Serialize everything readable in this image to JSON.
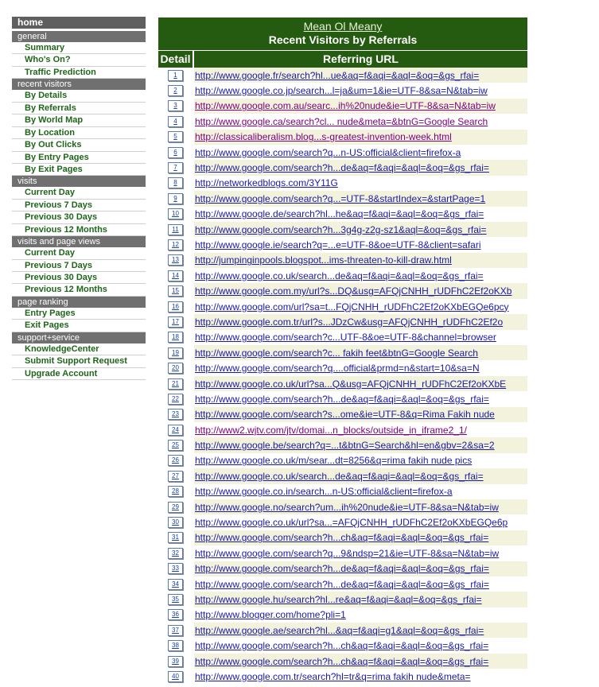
{
  "sidebar": {
    "home": "home",
    "sections": [
      {
        "heading": "general",
        "items": [
          "Summary",
          "Who's On?",
          "Traffic Prediction"
        ]
      },
      {
        "heading": "recent visitors",
        "items": [
          "By Details",
          "By Referrals",
          "By World Map",
          "By Location",
          "By Out Clicks",
          "By Entry Pages",
          "By Exit Pages"
        ]
      },
      {
        "heading": "visits",
        "items": [
          "Current Day",
          "Previous 7 Days",
          "Previous 30 Days",
          "Previous 12 Months"
        ]
      },
      {
        "heading": "visits and page views",
        "items": [
          "Current Day",
          "Previous 7 Days",
          "Previous 30 Days",
          "Previous 12 Months"
        ]
      },
      {
        "heading": "page ranking",
        "items": [
          "Entry Pages",
          "Exit Pages"
        ]
      },
      {
        "heading": "support+service",
        "items": [
          "KnowledgeCenter",
          "Submit Support Request",
          "Upgrade Account"
        ]
      }
    ]
  },
  "main": {
    "site_name": "Mean Ol Meany",
    "page_title": "Recent Visitors by Referrals",
    "col_detail": "Detail",
    "col_url": "Referring URL",
    "rows": [
      {
        "n": "1",
        "url": "http://www.google.fr/search?hl...ue&aq=f&aqi=&aql=&oq=&gs_rfai=",
        "visited": false
      },
      {
        "n": "2",
        "url": "http://www.google.co.jp/search...l=ja&um=1&ie=UTF-8&sa=N&tab=iw",
        "visited": false
      },
      {
        "n": "3",
        "url": "http://www.google.com.au/searc...ih%20nude&ie=UTF-8&sa=N&tab=iw",
        "visited": true
      },
      {
        "n": "4",
        "url": "http://www.google.ca/search?cl... nude&meta=&btnG=Google Search",
        "visited": true
      },
      {
        "n": "5",
        "url": "http://classicaliberalism.blog...s-greatest-invention-week.html",
        "visited": true
      },
      {
        "n": "6",
        "url": "http://www.google.com/search?q...n-US:official&client=firefox-a",
        "visited": false
      },
      {
        "n": "7",
        "url": "http://www.google.com/search?h...de&aq=f&aqi=&aql=&oq=&gs_rfai=",
        "visited": false
      },
      {
        "n": "8",
        "url": "http://networkedblogs.com/3Y11G",
        "visited": false
      },
      {
        "n": "9",
        "url": "http://www.google.com/search?q...=UTF-8&startIndex=&startPage=1",
        "visited": false
      },
      {
        "n": "10",
        "url": "http://www.google.de/search?hl...he&aq=f&aqi=&aql=&oq=&gs_rfai=",
        "visited": false
      },
      {
        "n": "11",
        "url": "http://www.google.com/search?h...3g4g-z2g-sz1&aql=&oq=&gs_rfai=",
        "visited": false
      },
      {
        "n": "12",
        "url": "http://www.google.ie/search?q=...e=UTF-8&oe=UTF-8&client=safari",
        "visited": false
      },
      {
        "n": "13",
        "url": "http://jumpinginpools.blogspot...ims-threaten-to-kill-draw.html",
        "visited": false
      },
      {
        "n": "14",
        "url": "http://www.google.co.uk/search...de&aq=f&aqi=&aql=&oq=&gs_rfai=",
        "visited": false
      },
      {
        "n": "15",
        "url": "http://www.google.com.my/url?s...DQ&usg=AFQjCNHH_rUDFhC2Ef2oKXb",
        "visited": false
      },
      {
        "n": "16",
        "url": "http://www.google.com/url?sa=t...FQjCNHH_rUDFhC2Ef2oKXbEGQe6pcy",
        "visited": false
      },
      {
        "n": "17",
        "url": "http://www.google.com.tr/url?s...JDzCw&usg=AFQjCNHH_rUDFhC2Ef2o",
        "visited": false
      },
      {
        "n": "18",
        "url": "http://www.google.com/search?c...UTF-8&oe=UTF-8&channel=browser",
        "visited": false
      },
      {
        "n": "19",
        "url": "http://www.google.com/search?c... fakih feet&btnG=Google Search",
        "visited": false
      },
      {
        "n": "20",
        "url": "http://www.google.com/search?q....official&prmd=n&start=10&sa=N",
        "visited": false
      },
      {
        "n": "21",
        "url": "http://www.google.co.uk/url?sa...Q&usg=AFQjCNHH_rUDFhC2Ef2oKXbE",
        "visited": false
      },
      {
        "n": "22",
        "url": "http://www.google.com/search?h...de&aq=f&aqi=&aql=&oq=&gs_rfai=",
        "visited": false
      },
      {
        "n": "23",
        "url": "http://www.google.com/search?s...ome&ie=UTF-8&q=Rima Fakih nude",
        "visited": false
      },
      {
        "n": "24",
        "url": "http://www2.wjtv.com/jtv/domai...n_blocks/outside_in_iframe2_1/",
        "visited": true
      },
      {
        "n": "25",
        "url": "http://www.google.be/search?q=...t&btnG=Search&hl=en&gbv=2&sa=2",
        "visited": false
      },
      {
        "n": "26",
        "url": "http://www.google.co.uk/m/sear...dt=8256&q=rima fakih nude pics",
        "visited": false
      },
      {
        "n": "27",
        "url": "http://www.google.co.uk/search...de&aq=f&aqi=&aql=&oq=&gs_rfai=",
        "visited": false
      },
      {
        "n": "28",
        "url": "http://www.google.co.in/search...n-US:official&client=firefox-a",
        "visited": false
      },
      {
        "n": "29",
        "url": "http://www.google.no/search?um...ih%20nude&ie=UTF-8&sa=N&tab=iw",
        "visited": false
      },
      {
        "n": "30",
        "url": "http://www.google.co.uk/url?sa...=AFQjCNHH_rUDFhC2Ef2oKXbEGQe6p",
        "visited": false
      },
      {
        "n": "31",
        "url": "http://www.google.com/search?h...ch&aq=f&aqi=&aql=&oq=&gs_rfai=",
        "visited": false
      },
      {
        "n": "32",
        "url": "http://www.google.com/search?q...9&ndsp=21&ie=UTF-8&sa=N&tab=iw",
        "visited": false
      },
      {
        "n": "33",
        "url": "http://www.google.com/search?h...de&aq=f&aqi=&aql=&oq=&gs_rfai=",
        "visited": false
      },
      {
        "n": "34",
        "url": "http://www.google.com/search?h...de&aq=f&aqi=&aql=&oq=&gs_rfai=",
        "visited": false
      },
      {
        "n": "35",
        "url": "http://www.google.hu/search?hl...re&aq=f&aqi=&aql=&oq=&gs_rfai=",
        "visited": false
      },
      {
        "n": "36",
        "url": "http://www.blogger.com/home?pli=1",
        "visited": false
      },
      {
        "n": "37",
        "url": "http://www.google.ae/search?hl...&aq=f&aqi=g1&aql=&oq=&gs_rfai=",
        "visited": false
      },
      {
        "n": "38",
        "url": "http://www.google.com/search?h...ch&aq=f&aqi=&aql=&oq=&gs_rfai=",
        "visited": false
      },
      {
        "n": "39",
        "url": "http://www.google.com/search?h...ch&aq=f&aqi=&aql=&oq=&gs_rfai=",
        "visited": false
      },
      {
        "n": "40",
        "url": "http://www.google.com.tr/search?hl=tr&q=rima fakih nude&meta=",
        "visited": false
      }
    ]
  }
}
